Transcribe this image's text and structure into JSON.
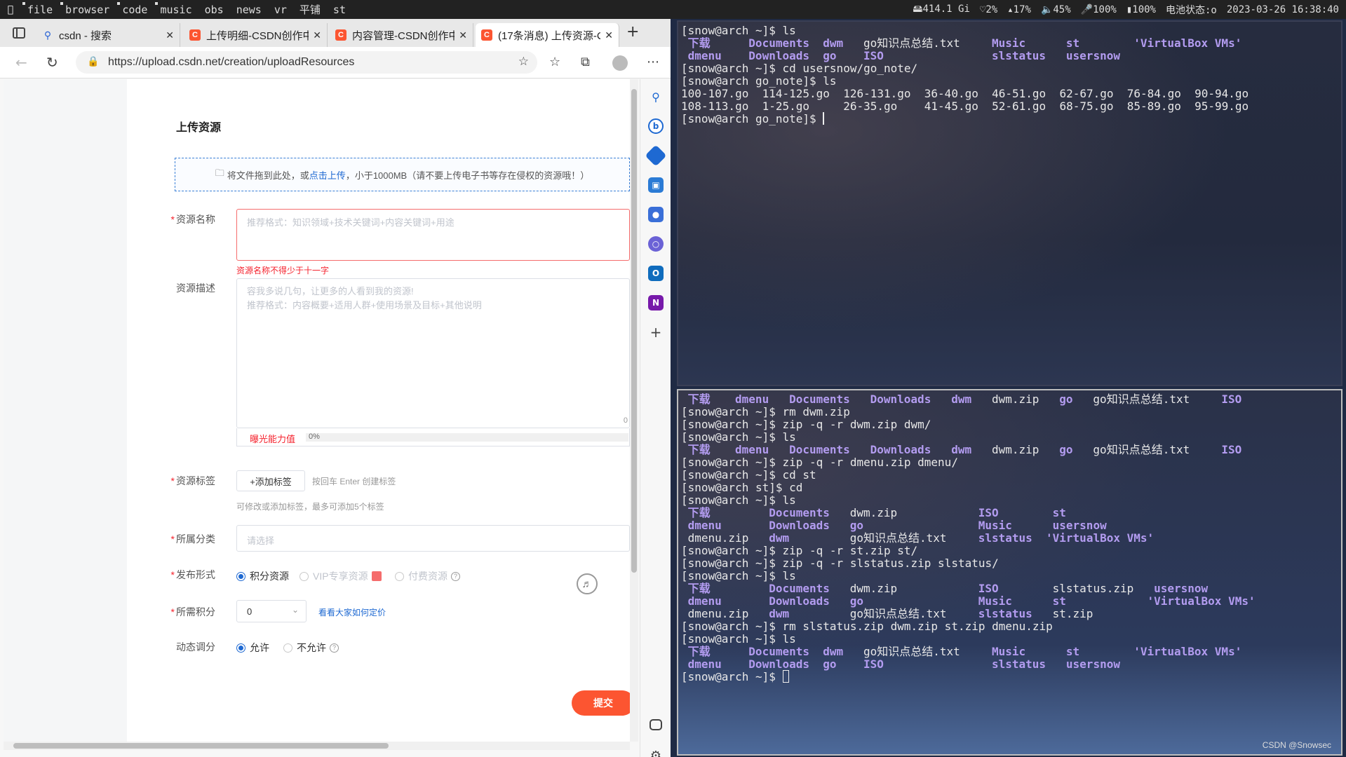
{
  "topbar": {
    "tags": [
      {
        "label": "file",
        "occupied": true
      },
      {
        "label": "browser",
        "occupied": true
      },
      {
        "label": "code",
        "occupied": true
      },
      {
        "label": "music",
        "occupied": true
      },
      {
        "label": "obs",
        "occupied": false
      },
      {
        "label": "news",
        "occupied": false
      },
      {
        "label": "vr",
        "occupied": false
      },
      {
        "label": "平铺",
        "occupied": false
      },
      {
        "label": "st",
        "occupied": false
      }
    ],
    "status": {
      "disk": "414.1 Gi",
      "cpu": "2%",
      "mem": "17%",
      "volume": "45%",
      "mic": "100%",
      "battery": "100%",
      "battery_state": "电池状态:o",
      "datetime": "2023-03-26 16:38:40"
    }
  },
  "browser": {
    "tabs": [
      {
        "title": "csdn - 搜索",
        "favicon": "search-icon",
        "active": false
      },
      {
        "title": "上传明细-CSDN创作中心",
        "favicon": "csdn-icon",
        "active": false
      },
      {
        "title": "内容管理-CSDN创作中心",
        "favicon": "csdn-icon",
        "active": false
      },
      {
        "title": "(17条消息) 上传资源-CSDN",
        "favicon": "csdn-icon",
        "active": true
      }
    ],
    "url": "https://upload.csdn.net/creation/uploadResources",
    "sidebar_icons": [
      "search-icon",
      "bing-icon",
      "tag-icon",
      "toolbox-icon",
      "people-icon",
      "office-icon",
      "outlook-icon",
      "onenote-icon",
      "plus-icon",
      "split-icon",
      "gear-icon"
    ]
  },
  "form": {
    "title": "上传资源",
    "dropzone": {
      "prefix": "将文件拖到此处，或",
      "link": "点击上传",
      "suffix": "，小于1000MB（请不要上传电子书等存在侵权的资源哦！）"
    },
    "name": {
      "label": "资源名称",
      "placeholder": "推荐格式：知识领域+技术关键词+内容关键词+用途",
      "error": "资源名称不得少于十一字"
    },
    "desc": {
      "label": "资源描述",
      "placeholder_line1": "容我多说几句，让更多的人看到我的资源!",
      "placeholder_line2": "推荐格式：内容概要+适用人群+使用场景及目标+其他说明",
      "count": "0"
    },
    "exposure": {
      "label": "曝光能力值",
      "percent": "0%"
    },
    "tags": {
      "label": "资源标签",
      "add_button": "+添加标签",
      "hint": "按回车 Enter 创建标签",
      "sub_hint": "可修改或添加标签，最多可添加5个标签"
    },
    "category": {
      "label": "所属分类",
      "placeholder": "请选择"
    },
    "publish": {
      "label": "发布形式",
      "opt1": "积分资源",
      "opt2": "VIP专享资源",
      "opt3": "付费资源"
    },
    "points": {
      "label": "所需积分",
      "value": "0",
      "link": "看看大家如何定价"
    },
    "dynamic": {
      "label": "动态调分",
      "opt1": "允许",
      "opt2": "不允许"
    },
    "submit": "提交"
  },
  "term1": {
    "lines": [
      {
        "type": "text",
        "text": "[snow@arch ~]$ ls"
      },
      {
        "type": "cells",
        "cells": [
          [
            "下载",
            1,
            true
          ],
          [
            "Documents",
            10,
            true
          ],
          [
            "dwm",
            21,
            true
          ],
          [
            "go知识点总结.txt",
            27,
            false
          ],
          [
            "Music",
            46,
            true
          ],
          [
            "st",
            57,
            true
          ],
          [
            "'VirtualBox VMs'",
            67,
            true
          ]
        ]
      },
      {
        "type": "cells",
        "cells": [
          [
            "dmenu",
            1,
            true
          ],
          [
            "Downloads",
            10,
            true
          ],
          [
            "go",
            21,
            true
          ],
          [
            "ISO",
            27,
            true
          ],
          [
            "slstatus",
            46,
            true
          ],
          [
            "usersnow",
            57,
            true
          ]
        ]
      },
      {
        "type": "text",
        "text": "[snow@arch ~]$ cd usersnow/go_note/"
      },
      {
        "type": "text",
        "text": "[snow@arch go_note]$ ls"
      },
      {
        "type": "text",
        "text": "100-107.go  114-125.go  126-131.go  36-40.go  46-51.go  62-67.go  76-84.go  90-94.go"
      },
      {
        "type": "text",
        "text": "108-113.go  1-25.go     26-35.go    41-45.go  52-61.go  68-75.go  85-89.go  95-99.go"
      },
      {
        "type": "prompt",
        "text": "[snow@arch go_note]$ "
      }
    ]
  },
  "term2": {
    "lines": [
      {
        "type": "cells",
        "cells": [
          [
            "下载",
            1,
            true
          ],
          [
            "dmenu",
            8,
            true
          ],
          [
            "Documents",
            16,
            true
          ],
          [
            "Downloads",
            28,
            true
          ],
          [
            "dwm",
            40,
            true
          ],
          [
            "dwm.zip",
            46,
            false
          ],
          [
            "go",
            56,
            true
          ],
          [
            "go知识点总结.txt",
            61,
            false
          ],
          [
            "ISO",
            80,
            true
          ]
        ]
      },
      {
        "type": "text",
        "text": "[snow@arch ~]$ rm dwm.zip"
      },
      {
        "type": "text",
        "text": "[snow@arch ~]$ zip -q -r dwm.zip dwm/"
      },
      {
        "type": "text",
        "text": "[snow@arch ~]$ ls"
      },
      {
        "type": "cells",
        "cells": [
          [
            "下载",
            1,
            true
          ],
          [
            "dmenu",
            8,
            true
          ],
          [
            "Documents",
            16,
            true
          ],
          [
            "Downloads",
            28,
            true
          ],
          [
            "dwm",
            40,
            true
          ],
          [
            "dwm.zip",
            46,
            false
          ],
          [
            "go",
            56,
            true
          ],
          [
            "go知识点总结.txt",
            61,
            false
          ],
          [
            "ISO",
            80,
            true
          ]
        ]
      },
      {
        "type": "text",
        "text": "[snow@arch ~]$ zip -q -r dmenu.zip dmenu/"
      },
      {
        "type": "text",
        "text": "[snow@arch ~]$ cd st"
      },
      {
        "type": "text",
        "text": "[snow@arch st]$ cd"
      },
      {
        "type": "text",
        "text": "[snow@arch ~]$ ls"
      },
      {
        "type": "cells",
        "cells": [
          [
            "下载",
            1,
            true
          ],
          [
            "Documents",
            13,
            true
          ],
          [
            "dwm.zip",
            25,
            false
          ],
          [
            "ISO",
            44,
            true
          ],
          [
            "st",
            55,
            true
          ]
        ]
      },
      {
        "type": "cells",
        "cells": [
          [
            "dmenu",
            1,
            true
          ],
          [
            "Downloads",
            13,
            true
          ],
          [
            "go",
            25,
            true
          ],
          [
            "Music",
            44,
            true
          ],
          [
            "usersnow",
            55,
            true
          ]
        ]
      },
      {
        "type": "cells",
        "cells": [
          [
            "dmenu.zip",
            1,
            false
          ],
          [
            "dwm",
            13,
            true
          ],
          [
            "go知识点总结.txt",
            25,
            false
          ],
          [
            "slstatus",
            44,
            true
          ],
          [
            "'VirtualBox VMs'",
            54,
            true
          ]
        ]
      },
      {
        "type": "text",
        "text": "[snow@arch ~]$ zip -q -r st.zip st/"
      },
      {
        "type": "text",
        "text": "[snow@arch ~]$ zip -q -r slstatus.zip slstatus/"
      },
      {
        "type": "text",
        "text": "[snow@arch ~]$ ls"
      },
      {
        "type": "cells",
        "cells": [
          [
            "下载",
            1,
            true
          ],
          [
            "Documents",
            13,
            true
          ],
          [
            "dwm.zip",
            25,
            false
          ],
          [
            "ISO",
            44,
            true
          ],
          [
            "slstatus.zip",
            55,
            false
          ],
          [
            "usersnow",
            70,
            true
          ]
        ]
      },
      {
        "type": "cells",
        "cells": [
          [
            "dmenu",
            1,
            true
          ],
          [
            "Downloads",
            13,
            true
          ],
          [
            "go",
            25,
            true
          ],
          [
            "Music",
            44,
            true
          ],
          [
            "st",
            55,
            true
          ],
          [
            "'VirtualBox VMs'",
            69,
            true
          ]
        ]
      },
      {
        "type": "cells",
        "cells": [
          [
            "dmenu.zip",
            1,
            false
          ],
          [
            "dwm",
            13,
            true
          ],
          [
            "go知识点总结.txt",
            25,
            false
          ],
          [
            "slstatus",
            44,
            true
          ],
          [
            "st.zip",
            55,
            false
          ]
        ]
      },
      {
        "type": "text",
        "text": "[snow@arch ~]$ rm slstatus.zip dwm.zip st.zip dmenu.zip"
      },
      {
        "type": "text",
        "text": "[snow@arch ~]$ ls"
      },
      {
        "type": "cells",
        "cells": [
          [
            "下载",
            1,
            true
          ],
          [
            "Documents",
            10,
            true
          ],
          [
            "dwm",
            21,
            true
          ],
          [
            "go知识点总结.txt",
            27,
            false
          ],
          [
            "Music",
            46,
            true
          ],
          [
            "st",
            57,
            true
          ],
          [
            "'VirtualBox VMs'",
            67,
            true
          ]
        ]
      },
      {
        "type": "cells",
        "cells": [
          [
            "dmenu",
            1,
            true
          ],
          [
            "Downloads",
            10,
            true
          ],
          [
            "go",
            21,
            true
          ],
          [
            "ISO",
            27,
            true
          ],
          [
            "slstatus",
            46,
            true
          ],
          [
            "usersnow",
            57,
            true
          ]
        ]
      },
      {
        "type": "prompt_box",
        "text": "[snow@arch ~]$ "
      }
    ],
    "watermark": "CSDN @Snowsec"
  }
}
